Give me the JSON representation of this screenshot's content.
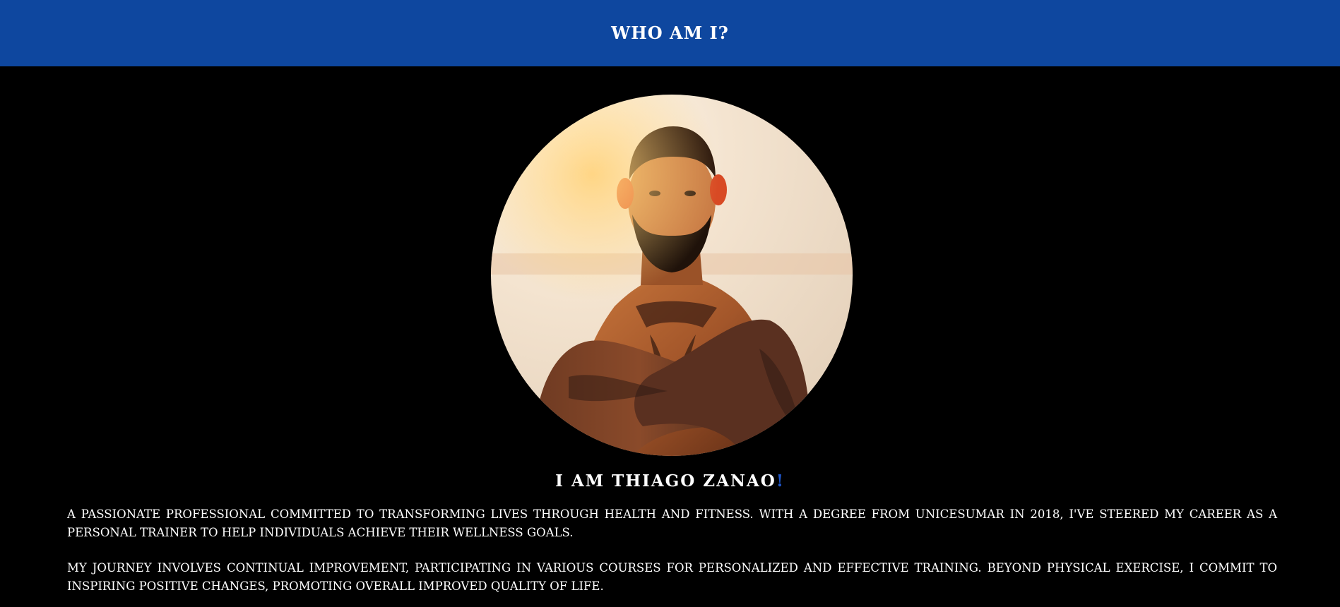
{
  "header": {
    "title": "WHO AM I?"
  },
  "profile": {
    "portrait_icon": "portrait-photo",
    "name_heading": "I AM THIAGO ZANAO",
    "name_accent": "!",
    "paragraphs": [
      "A PASSIONATE PROFESSIONAL COMMITTED TO TRANSFORMING LIVES THROUGH HEALTH AND FITNESS. WITH A DEGREE FROM UNICESUMAR IN 2018, I'VE STEERED MY CAREER AS A PERSONAL TRAINER TO HELP INDIVIDUALS ACHIEVE THEIR WELLNESS GOALS.",
      "MY JOURNEY INVOLVES CONTINUAL IMPROVEMENT, PARTICIPATING IN VARIOUS COURSES FOR PERSONALIZED AND EFFECTIVE TRAINING. BEYOND PHYSICAL EXERCISE, I COMMIT TO INSPIRING POSITIVE CHANGES, PROMOTING OVERALL IMPROVED QUALITY OF LIFE."
    ]
  },
  "colors": {
    "header_bg": "#0e479f",
    "page_bg": "#000000",
    "text": "#ffffff",
    "accent": "#1f56c9"
  }
}
